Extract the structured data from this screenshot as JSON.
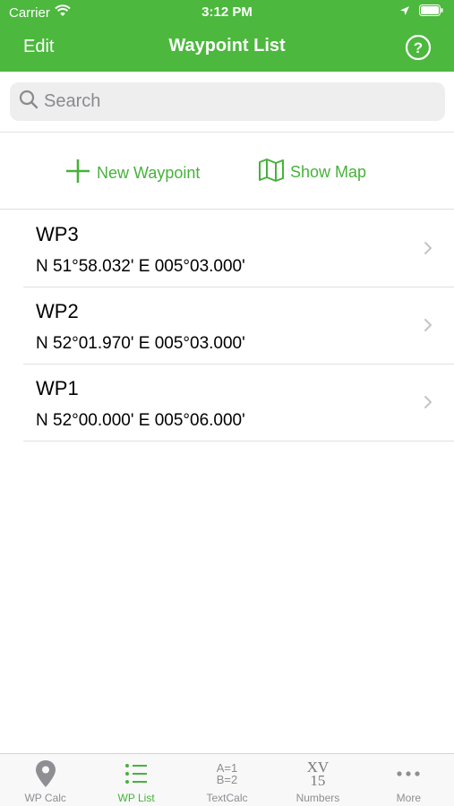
{
  "status_bar": {
    "carrier": "Carrier",
    "time": "3:12 PM"
  },
  "nav": {
    "edit_label": "Edit",
    "title": "Waypoint List",
    "help_icon": "question-circle-icon"
  },
  "search": {
    "placeholder": "Search",
    "value": ""
  },
  "actions": {
    "new_waypoint_label": "New Waypoint",
    "show_map_label": "Show Map"
  },
  "waypoints": [
    {
      "name": "WP3",
      "coords": "N 51°58.032' E 005°03.000'"
    },
    {
      "name": "WP2",
      "coords": "N 52°01.970' E 005°03.000'"
    },
    {
      "name": "WP1",
      "coords": "N 52°00.000' E 005°06.000'"
    }
  ],
  "tabs": [
    {
      "label": "WP Calc",
      "icon": "map-pin-icon"
    },
    {
      "label": "WP List",
      "icon": "list-icon",
      "active": true
    },
    {
      "label": "TextCalc",
      "icon": "textcalc-icon",
      "icon_text_1": "A=1",
      "icon_text_2": "B=2"
    },
    {
      "label": "Numbers",
      "icon": "roman-numerals-icon",
      "icon_text_1": "XV",
      "icon_text_2": "15"
    },
    {
      "label": "More",
      "icon": "more-dots-icon"
    }
  ],
  "colors": {
    "accent": "#4cb83e",
    "tint": "#46b23a",
    "inactive": "#8e8e93"
  }
}
